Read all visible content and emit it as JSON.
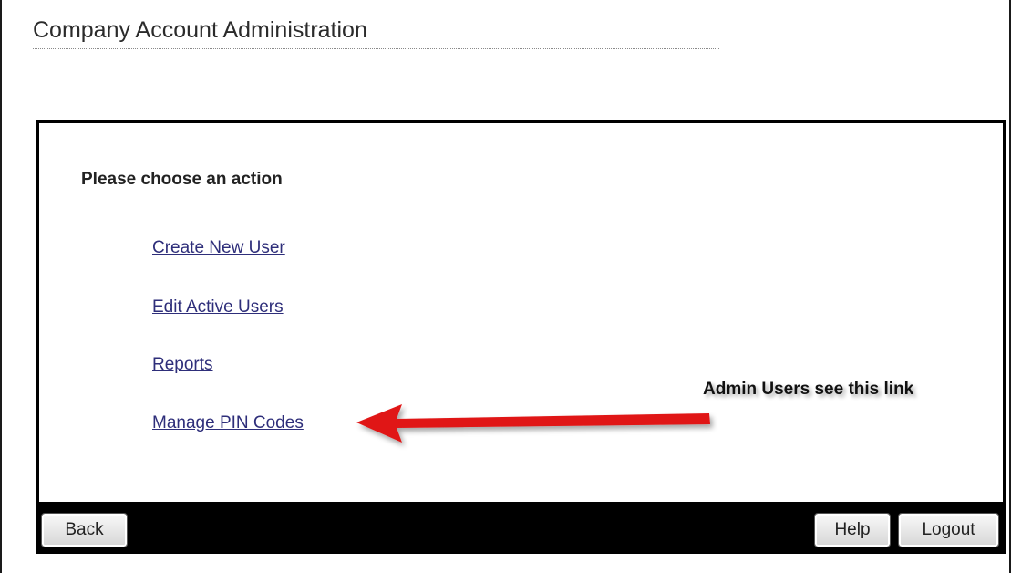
{
  "header": {
    "title": "Company Account Administration"
  },
  "panel": {
    "heading": "Please choose an action",
    "links": [
      {
        "label": "Create New User"
      },
      {
        "label": "Edit Active Users"
      },
      {
        "label": "Reports"
      },
      {
        "label": "Manage PIN Codes"
      }
    ]
  },
  "annotation": {
    "note": "Admin Users see this link",
    "arrow_color": "#e01414"
  },
  "footer": {
    "back_label": "Back",
    "help_label": "Help",
    "logout_label": "Logout"
  },
  "colors": {
    "link": "#2e2e7a",
    "border": "#000000",
    "bar": "#000000"
  }
}
